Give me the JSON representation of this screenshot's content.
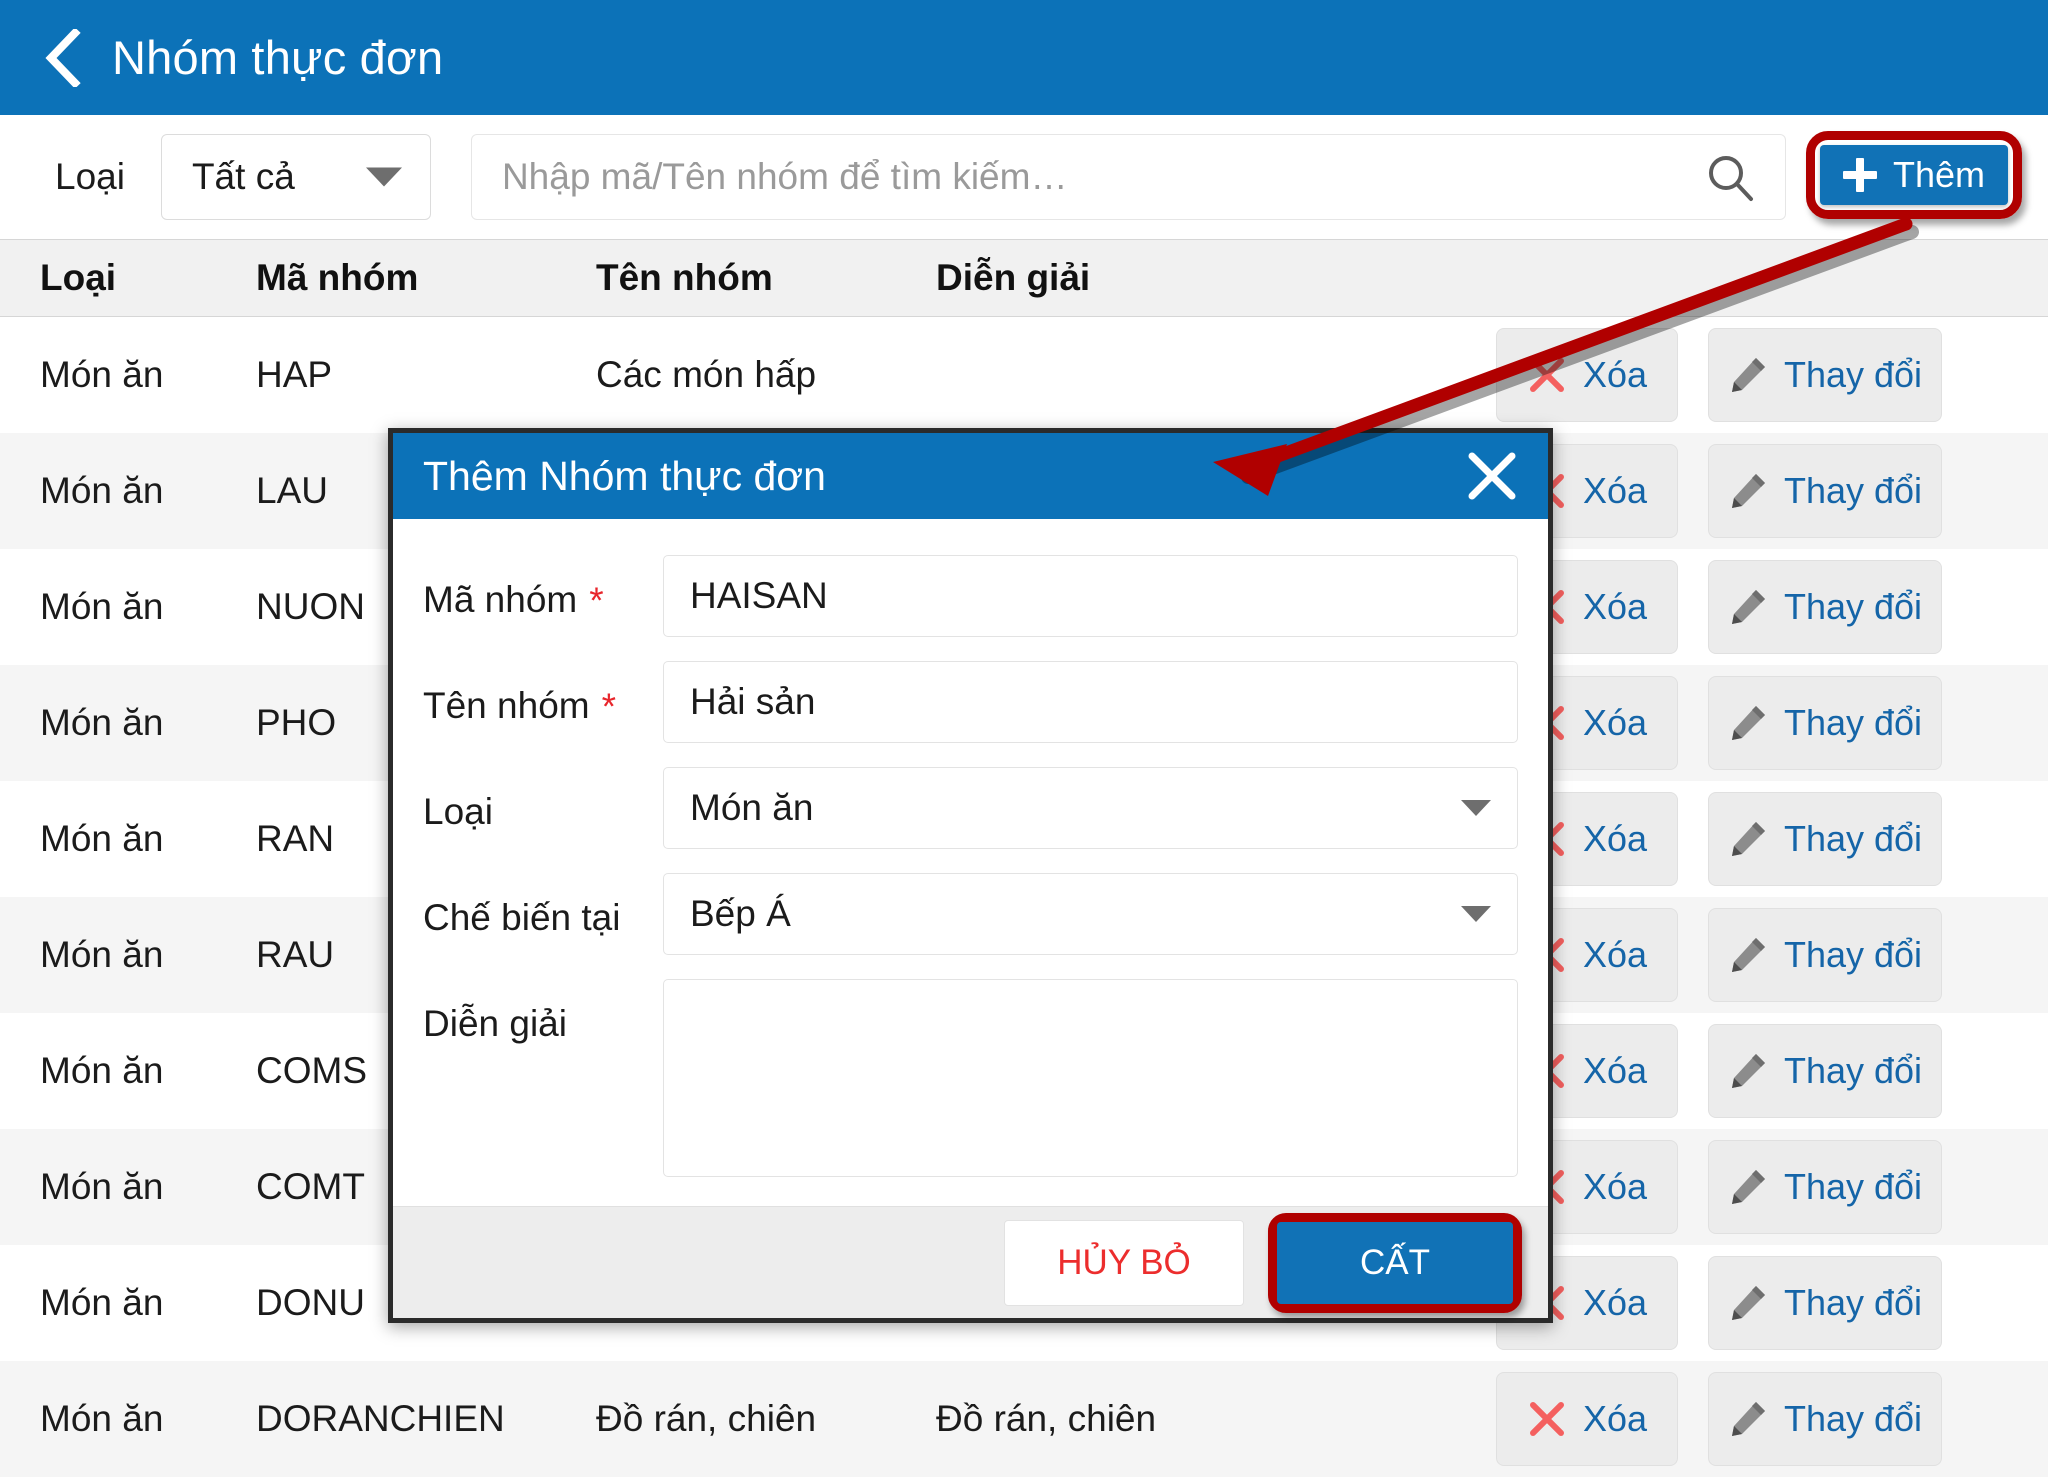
{
  "appbar": {
    "back_icon": "chevron-left-icon",
    "title": "Nhóm thực đơn"
  },
  "toolbar": {
    "type_label": "Loại",
    "type_value": "Tất cả",
    "search_placeholder": "Nhập mã/Tên nhóm để tìm kiếm…",
    "search_value": "",
    "search_icon": "search-icon",
    "add_label": "Thêm",
    "add_icon": "plus-icon"
  },
  "table": {
    "headers": [
      "Loại",
      "Mã nhóm",
      "Tên nhóm",
      "Diễn giải"
    ],
    "action_delete_label": "Xóa",
    "action_edit_label": "Thay đổi",
    "delete_icon": "x-icon",
    "edit_icon": "pencil-icon",
    "rows": [
      {
        "loai": "Món ăn",
        "ma": "HAP",
        "ten": "Các món hấp",
        "dien": ""
      },
      {
        "loai": "Món ăn",
        "ma": "LAU",
        "ten": "",
        "dien": ""
      },
      {
        "loai": "Món ăn",
        "ma": "NUON",
        "ten": "",
        "dien": ""
      },
      {
        "loai": "Món ăn",
        "ma": "PHO",
        "ten": "",
        "dien": ""
      },
      {
        "loai": "Món ăn",
        "ma": "RAN",
        "ten": "",
        "dien": ""
      },
      {
        "loai": "Món ăn",
        "ma": "RAU",
        "ten": "",
        "dien": ""
      },
      {
        "loai": "Món ăn",
        "ma": "COMS",
        "ten": "",
        "dien": ""
      },
      {
        "loai": "Món ăn",
        "ma": "COMT",
        "ten": "",
        "dien": ""
      },
      {
        "loai": "Món ăn",
        "ma": "DONU",
        "ten": "",
        "dien": ""
      },
      {
        "loai": "Món ăn",
        "ma": "DORANCHIEN",
        "ten": "Đồ rán, chiên",
        "dien": "Đồ rán, chiên"
      }
    ]
  },
  "dialog": {
    "title": "Thêm Nhóm thực đơn",
    "close_icon": "close-icon",
    "fields": {
      "ma_nhom_label": "Mã nhóm",
      "ma_nhom_value": "HAISAN",
      "ten_nhom_label": "Tên nhóm",
      "ten_nhom_value": "Hải sản",
      "loai_label": "Loại",
      "loai_value": "Món ăn",
      "che_bien_label": "Chế biến tại",
      "che_bien_value": "Bếp Á",
      "dien_giai_label": "Diễn giải",
      "dien_giai_value": "",
      "required_mark": "*"
    },
    "cancel_label": "HỦY BỎ",
    "save_label": "CẤT"
  },
  "annotation": {
    "highlight_color": "#b00000",
    "arrow_icon": "red-arrow-annotation"
  },
  "colors": {
    "brand_blue": "#0c72b8",
    "button_blue": "#1172b6",
    "link_blue": "#1565a8",
    "required_red": "#e8262c",
    "cancel_red": "#ec2d2d",
    "row_alt": "#f5f5f5",
    "header_gray": "#f1f1f1"
  }
}
